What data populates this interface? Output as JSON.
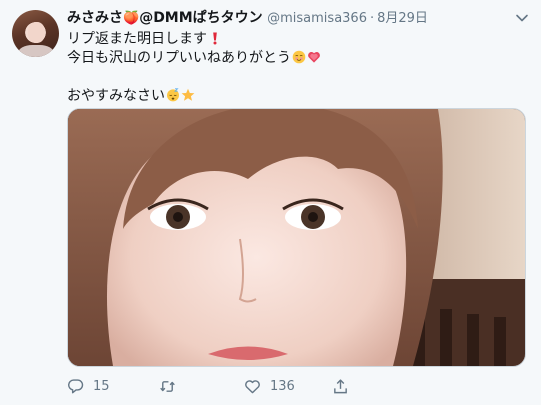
{
  "tweet": {
    "display_name_prefix": "みさみさ",
    "display_name_suffix": "@DMMぱちタウン",
    "peach_emoji": "🍑",
    "handle": "@misamisa366",
    "dot": "·",
    "date": "8月29日",
    "lines": [
      "リプ返また明日します",
      "今日も沢山のリプいいねありがとう",
      "",
      "おやすみなさい"
    ],
    "replies": "15",
    "retweets": "",
    "likes": "136"
  },
  "icons": {
    "more": "chevron-down-icon",
    "reply": "reply-icon",
    "retweet": "retweet-icon",
    "like": "heart-icon",
    "share": "share-icon"
  },
  "colors": {
    "text": "#14171a",
    "muted": "#657786",
    "background": "#f5f8fa",
    "border": "#ccd6dd"
  }
}
